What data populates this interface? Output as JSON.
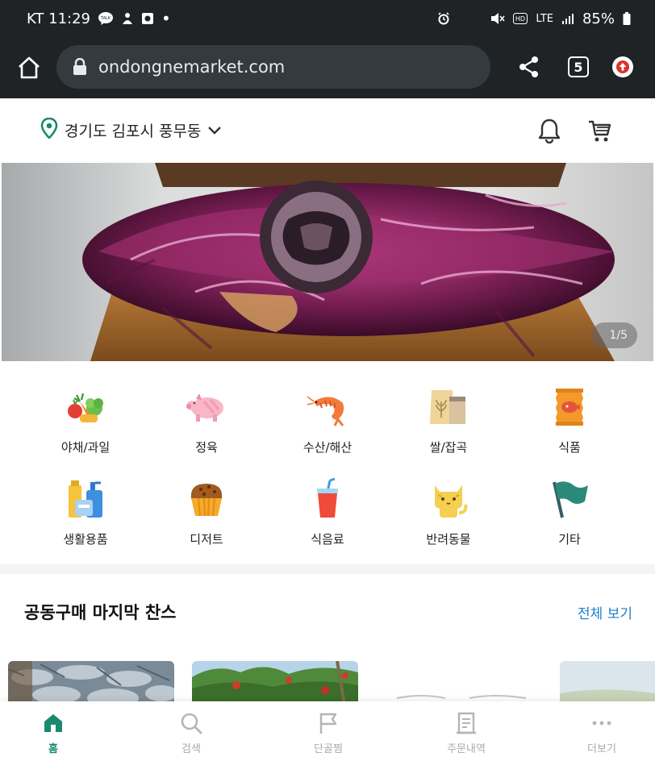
{
  "status_bar": {
    "carrier_time": "KT 11:29",
    "dot": "•",
    "network": "LTE",
    "battery": "85%",
    "icons": [
      "talk-icon",
      "notification-icon",
      "camera-icon",
      "alarm-icon",
      "mute-icon",
      "hd-icon",
      "signal-icon",
      "battery-icon"
    ]
  },
  "browser": {
    "url": "ondongnemarket.com",
    "tab_count": "5",
    "icons": [
      "home-icon",
      "lock-icon",
      "share-icon",
      "tabs-icon",
      "update-icon"
    ]
  },
  "header": {
    "location": "경기도 김포시 풍무동",
    "icons": [
      "location-pin-icon",
      "chevron-down-icon",
      "bell-icon",
      "cart-icon"
    ]
  },
  "banner": {
    "counter": "1/5"
  },
  "categories": [
    {
      "label": "야채/과일",
      "icon": "vegetables-icon"
    },
    {
      "label": "정육",
      "icon": "pig-icon"
    },
    {
      "label": "수산/해산",
      "icon": "shrimp-icon"
    },
    {
      "label": "쌀/잡곡",
      "icon": "rice-bag-icon"
    },
    {
      "label": "식품",
      "icon": "snack-pack-icon"
    },
    {
      "label": "생활용품",
      "icon": "household-icon"
    },
    {
      "label": "디저트",
      "icon": "muffin-icon"
    },
    {
      "label": "식음료",
      "icon": "drink-icon"
    },
    {
      "label": "반려동물",
      "icon": "cat-icon"
    },
    {
      "label": "기타",
      "icon": "flag-icon"
    }
  ],
  "section": {
    "title": "공동구매 마지막 찬스",
    "see_all": "전체 보기"
  },
  "bottom_nav": [
    {
      "label": "홈",
      "icon": "home-icon",
      "active": true
    },
    {
      "label": "검색",
      "icon": "search-icon",
      "active": false
    },
    {
      "label": "단골찜",
      "icon": "flag-icon",
      "active": false
    },
    {
      "label": "주문내역",
      "icon": "receipt-icon",
      "active": false
    },
    {
      "label": "더보기",
      "icon": "more-icon",
      "active": false
    }
  ],
  "colors": {
    "chrome_bg": "#1f2326",
    "brand_green": "#1a8a6e",
    "link_blue": "#1e7fc9"
  }
}
